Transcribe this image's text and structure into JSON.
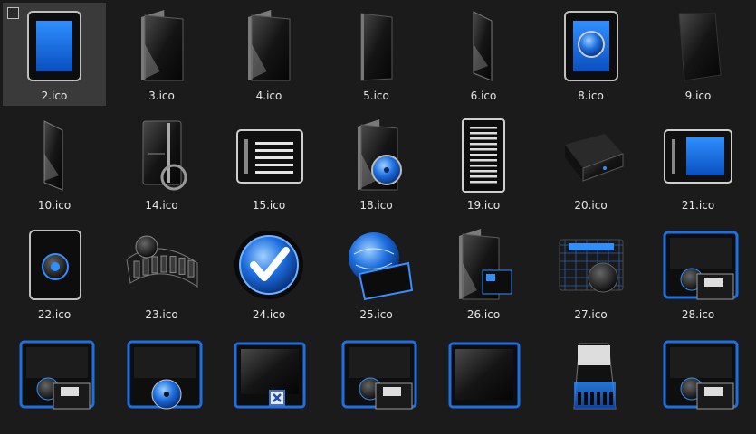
{
  "folder": {
    "selected_index": 0,
    "items": [
      {
        "name": "2.ico",
        "icon": "blue-screen-tablet"
      },
      {
        "name": "3.ico",
        "icon": "black-folder"
      },
      {
        "name": "4.ico",
        "icon": "black-folder"
      },
      {
        "name": "5.ico",
        "icon": "black-folder-thin"
      },
      {
        "name": "6.ico",
        "icon": "black-folder-side"
      },
      {
        "name": "8.ico",
        "icon": "tablet-with-disc"
      },
      {
        "name": "9.ico",
        "icon": "black-sheet"
      },
      {
        "name": "10.ico",
        "icon": "black-folder-side"
      },
      {
        "name": "14.ico",
        "icon": "ps3-console"
      },
      {
        "name": "15.ico",
        "icon": "list-document"
      },
      {
        "name": "18.ico",
        "icon": "folder-with-disc"
      },
      {
        "name": "19.ico",
        "icon": "text-document"
      },
      {
        "name": "20.ico",
        "icon": "external-drive"
      },
      {
        "name": "21.ico",
        "icon": "blue-screen-monitor"
      },
      {
        "name": "22.ico",
        "icon": "speaker-tablet"
      },
      {
        "name": "23.ico",
        "icon": "film-reel"
      },
      {
        "name": "24.ico",
        "icon": "blue-checkmark"
      },
      {
        "name": "25.ico",
        "icon": "globe-network"
      },
      {
        "name": "26.ico",
        "icon": "folder-with-computer"
      },
      {
        "name": "27.ico",
        "icon": "network-sphere"
      },
      {
        "name": "28.ico",
        "icon": "computer-floppy"
      },
      {
        "name": "",
        "icon": "computer-floppy"
      },
      {
        "name": "",
        "icon": "computer-disc"
      },
      {
        "name": "",
        "icon": "monitor-close"
      },
      {
        "name": "",
        "icon": "computer-floppy"
      },
      {
        "name": "",
        "icon": "monitor-blank"
      },
      {
        "name": "",
        "icon": "memory-card"
      },
      {
        "name": "",
        "icon": "computer-floppy"
      }
    ]
  }
}
